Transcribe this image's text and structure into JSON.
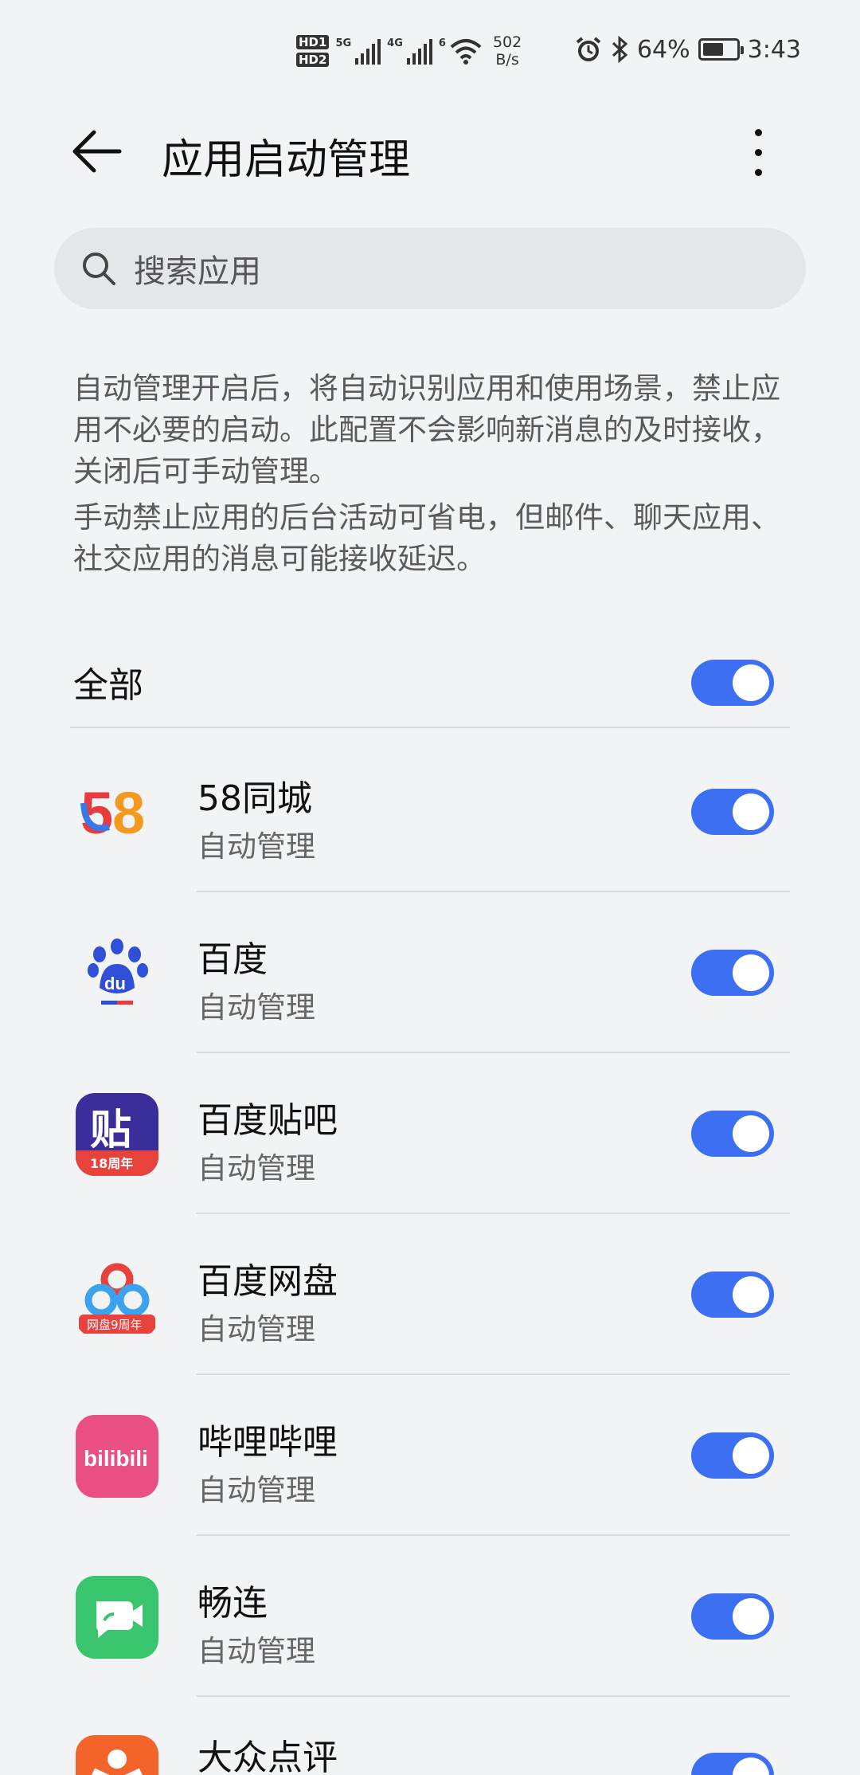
{
  "status_bar": {
    "hd1": "HD1",
    "hd2": "HD2",
    "net1": "5G",
    "net2": "4G",
    "wifi_tag": "6",
    "speed_value": "502",
    "speed_unit": "B/s",
    "battery": "64%",
    "battery_level": 0.64,
    "time": "3:43"
  },
  "header": {
    "title": "应用启动管理"
  },
  "search": {
    "placeholder": "搜索应用"
  },
  "description": {
    "para1": "自动管理开启后，将自动识别应用和使用场景，禁止应用不必要的启动。此配置不会影响新消息的及时接收，关闭后可手动管理。",
    "para2": "手动禁止应用的后台活动可省电，但邮件、聊天应用、社交应用的消息可能接收延迟。"
  },
  "all_row": {
    "label": "全部",
    "enabled": true
  },
  "apps": [
    {
      "name": "58同城",
      "status": "自动管理",
      "enabled": true,
      "icon": "58-logo-icon"
    },
    {
      "name": "百度",
      "status": "自动管理",
      "enabled": true,
      "icon": "baidu-paw-icon"
    },
    {
      "name": "百度贴吧",
      "status": "自动管理",
      "enabled": true,
      "icon": "tieba-icon",
      "icon_text": "贴",
      "icon_badge": "18周年"
    },
    {
      "name": "百度网盘",
      "status": "自动管理",
      "enabled": true,
      "icon": "netdisk-icon",
      "icon_badge": "网盘9周年"
    },
    {
      "name": "哔哩哔哩",
      "status": "自动管理",
      "enabled": true,
      "icon": "bilibili-icon",
      "icon_text": "bilibili"
    },
    {
      "name": "畅连",
      "status": "自动管理",
      "enabled": true,
      "icon": "changlian-icon"
    },
    {
      "name": "大众点评",
      "status": "",
      "enabled": true,
      "icon": "dianping-icon"
    }
  ],
  "colors": {
    "accent": "#3d6ff2",
    "background": "#f1f3f5"
  }
}
